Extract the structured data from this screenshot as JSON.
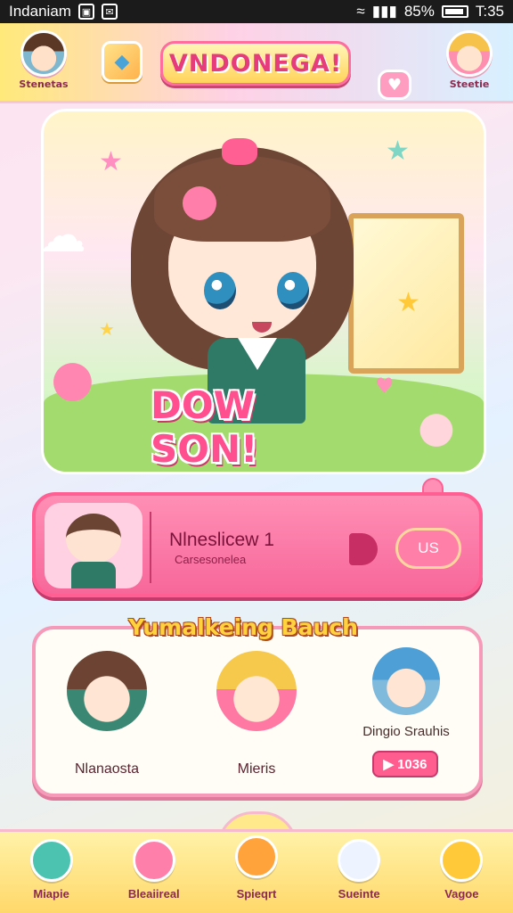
{
  "status_bar": {
    "app_name": "Indaniam",
    "battery_percent": "85%",
    "time": "T:35",
    "icons": [
      "wifi-icon",
      "signal-icon",
      "battery-icon",
      "notification-icon"
    ]
  },
  "header": {
    "title": "VNDONEGA!",
    "left_avatar_label": "Stenetas",
    "right_avatar_label": "Steetie",
    "gem_icon": "gem-icon",
    "heart_icon": "heart-icon"
  },
  "hero": {
    "banner_text": "DOW SON!"
  },
  "profile_card": {
    "name": "Nlneslicew 1",
    "subtitle": "Carsesonelea",
    "action_label": "US"
  },
  "recommend": {
    "title": "Yumalkeing Bauch",
    "characters": [
      {
        "label": "Nlanaosta"
      },
      {
        "label": "Mieris"
      },
      {
        "label": "Dingio Srauhis",
        "price": "1036"
      }
    ]
  },
  "bottom_nav": {
    "items": [
      {
        "label": "Miapie"
      },
      {
        "label": "Bleaiireal"
      },
      {
        "label": "Spieqrt"
      },
      {
        "label": "Sueinte"
      },
      {
        "label": "Vagoe"
      }
    ]
  },
  "colors": {
    "primary_pink": "#ff5f93",
    "accent_yellow": "#ffd23e",
    "nav_bg": "#ffd86a"
  }
}
